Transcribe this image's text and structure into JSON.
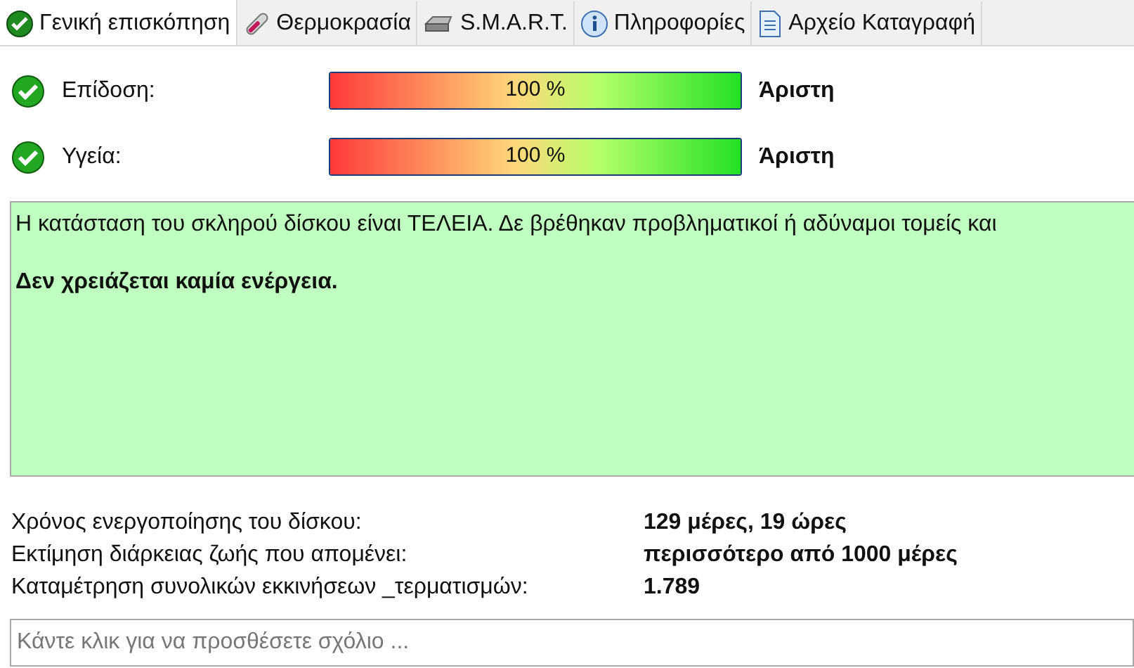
{
  "tabs": [
    {
      "label": "Γενική επισκόπηση",
      "kind": "check",
      "selected": true
    },
    {
      "label": "Θερμοκρασία",
      "kind": "thermometer",
      "selected": false
    },
    {
      "label": "S.M.A.R.T.",
      "kind": "drive",
      "selected": false
    },
    {
      "label": "Πληροφορίες",
      "kind": "info",
      "selected": false
    },
    {
      "label": "Αρχείο Καταγραφή",
      "kind": "document",
      "selected": false
    }
  ],
  "meters": [
    {
      "label": "Επίδοση:",
      "level": 1,
      "reading": "100 %",
      "rating": "Άριστη"
    },
    {
      "label": "Υγεία:",
      "level": 1,
      "reading": "100 %",
      "rating": "Άριστη"
    }
  ],
  "status_message": {
    "text": "Η κατάσταση του σκληρού δίσκου είναι ΤΕΛΕΙΑ. Δε βρέθηκαν προβληματικοί ή αδύναμοι τομείς και",
    "action": "Δεν χρειάζεται καμία ενέργεια."
  },
  "details": [
    {
      "label": "Χρόνος ενεργοποίησης του δίσκου:",
      "value": "129 μέρες, 19 ώρες"
    },
    {
      "label": "Εκτίμηση διάρκειας ζωής που απομένει:",
      "value": "περισσότερο από 1000 μέρες"
    },
    {
      "label": "Καταμέτρηση συνολικών εκκινήσεων _τερματισμών:",
      "value": "1.789"
    }
  ],
  "comment": {
    "placeholder": "Κάντε κλικ για να προσθέσετε σχόλιο ..."
  }
}
